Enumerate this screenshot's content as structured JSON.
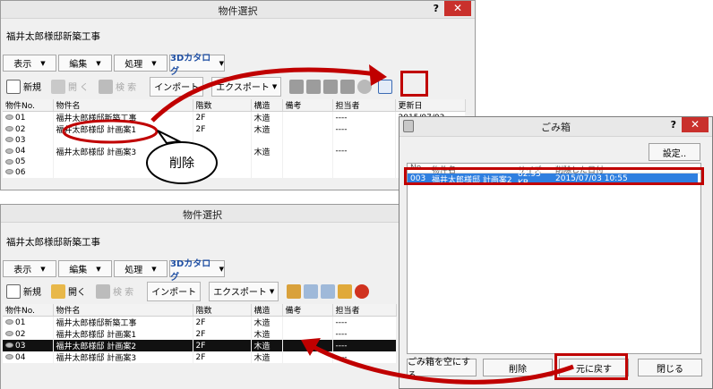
{
  "top_window": {
    "title": "物件選択",
    "help": "?",
    "close": "✕",
    "project": "福井太郎様邸新築工事",
    "menus": [
      "表示",
      "編集",
      "処理",
      "3Dカタログ"
    ],
    "toolbar": {
      "new": "新規",
      "open": "開",
      "open2": "く",
      "search": "検 索",
      "import": "インポート",
      "export": "エクスポート"
    },
    "columns": [
      "物件No.",
      "物件名",
      "階数",
      "構造",
      "備考",
      "担当者",
      "更新日"
    ],
    "rows": [
      {
        "no": "01",
        "name": "福井太郎様邸新築工事",
        "floors": "2F",
        "struct": "木造",
        "person": "----",
        "date": "2015/07/03"
      },
      {
        "no": "02",
        "name": "福井太郎様邸 計画案1",
        "floors": "2F",
        "struct": "木造",
        "person": "----",
        "date": ""
      },
      {
        "no": "03",
        "name": "",
        "floors": "",
        "struct": "",
        "person": "",
        "date": ""
      },
      {
        "no": "04",
        "name": "福井太郎様邸 計画案3",
        "floors": "2F",
        "struct": "木造",
        "person": "----",
        "date": ""
      },
      {
        "no": "05",
        "name": "",
        "floors": "",
        "struct": "",
        "person": "",
        "date": ""
      },
      {
        "no": "06",
        "name": "",
        "floors": "",
        "struct": "",
        "person": "",
        "date": ""
      }
    ]
  },
  "callout": "削除",
  "bottom_window": {
    "title": "物件選択",
    "project": "福井太郎様邸新築工事",
    "menus": [
      "表示",
      "編集",
      "処理",
      "3Dカタログ"
    ],
    "toolbar": {
      "new": "新規",
      "open": "開く",
      "search": "検 索",
      "import": "インポート",
      "export": "エクスポート"
    },
    "columns": [
      "物件No.",
      "物件名",
      "階数",
      "構造",
      "備考",
      "担当者"
    ],
    "rows": [
      {
        "no": "01",
        "name": "福井太郎様邸新築工事",
        "floors": "2F",
        "struct": "木造",
        "person": "----"
      },
      {
        "no": "02",
        "name": "福井太郎様邸 計画案1",
        "floors": "2F",
        "struct": "木造",
        "person": "----"
      },
      {
        "no": "03",
        "name": "福井太郎様邸 計画案2",
        "floors": "2F",
        "struct": "木造",
        "person": "----",
        "selected": true
      },
      {
        "no": "04",
        "name": "福井太郎様邸 計画案3",
        "floors": "2F",
        "struct": "木造",
        "person": "----"
      }
    ]
  },
  "trash_window": {
    "title": "ごみ箱",
    "help": "?",
    "close": "✕",
    "settings": "設定..",
    "columns": [
      "No.",
      "物件名",
      "サイズ",
      "削除した日付"
    ],
    "row": {
      "no": "003",
      "name": "福井太郎様邸 計画案2",
      "size": "82.93 KB",
      "date": "2015/07/03 10:55"
    },
    "buttons": {
      "empty": "ごみ箱を空にする",
      "delete": "削除",
      "restore": "元に戻す",
      "close": "閉じる"
    }
  }
}
